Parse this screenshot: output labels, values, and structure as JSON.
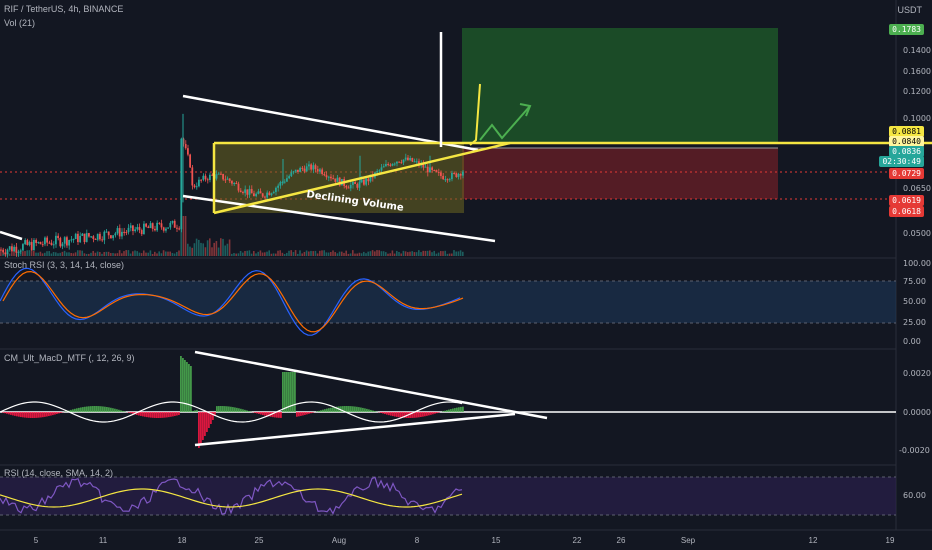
{
  "header": {
    "symbol": "RIF / TetherUS, 4h, BINANCE",
    "volume_label": "Vol (21)",
    "currency": "USDT"
  },
  "panes": {
    "stoch_label": "Stoch RSI (3, 3, 14, 14, close)",
    "macd_label": "CM_Ult_MacD_MTF (, 12, 26, 9)",
    "rsi_label": "RSI (14, close, SMA, 14, 2)"
  },
  "annotation": "Declining Volume",
  "price_axis": [
    "0.1600",
    "0.1400",
    "0.1200",
    "0.1000",
    "0.0650",
    "0.0500"
  ],
  "price_tags": [
    {
      "text": "0.1783",
      "color": "#4caf50"
    },
    {
      "text": "0.0881",
      "color": "#f5e642",
      "fg": "#000000"
    },
    {
      "text": "0.0840",
      "color": "#fff59d",
      "fg": "#000000"
    },
    {
      "text": "0.0836",
      "color": "#26a69a"
    },
    {
      "text": "02:30:49",
      "color": "#26a69a"
    },
    {
      "text": "0.0729",
      "color": "#e53935"
    },
    {
      "text": "0.0619",
      "color": "#e53935"
    },
    {
      "text": "0.0618",
      "color": "#e53935"
    }
  ],
  "stoch_axis": [
    "100.00",
    "75.00",
    "50.00",
    "25.00",
    "0.00"
  ],
  "macd_axis": [
    "0.0020",
    "0.0000",
    "-0.0020"
  ],
  "rsi_axis": [
    "60.00"
  ],
  "x_axis": [
    "5",
    "11",
    "18",
    "25",
    "Aug",
    "8",
    "15",
    "22",
    "26",
    "Sep",
    "12",
    "19"
  ],
  "chart_data": {
    "type": "line",
    "title": "RIF / TetherUS, 4h, BINANCE",
    "series": [
      {
        "name": "RIF / TetherUS",
        "x": [
          "5",
          "11",
          "18",
          "25",
          "Aug",
          "8",
          "15"
        ],
        "values": [
          0.052,
          0.054,
          0.118,
          0.076,
          0.078,
          0.083,
          0.0836
        ]
      }
    ],
    "ylabel": "USDT",
    "levels": {
      "take_profit": 0.1783,
      "resistance": 0.0881,
      "entry": 0.0836,
      "stop": 0.0618
    }
  }
}
